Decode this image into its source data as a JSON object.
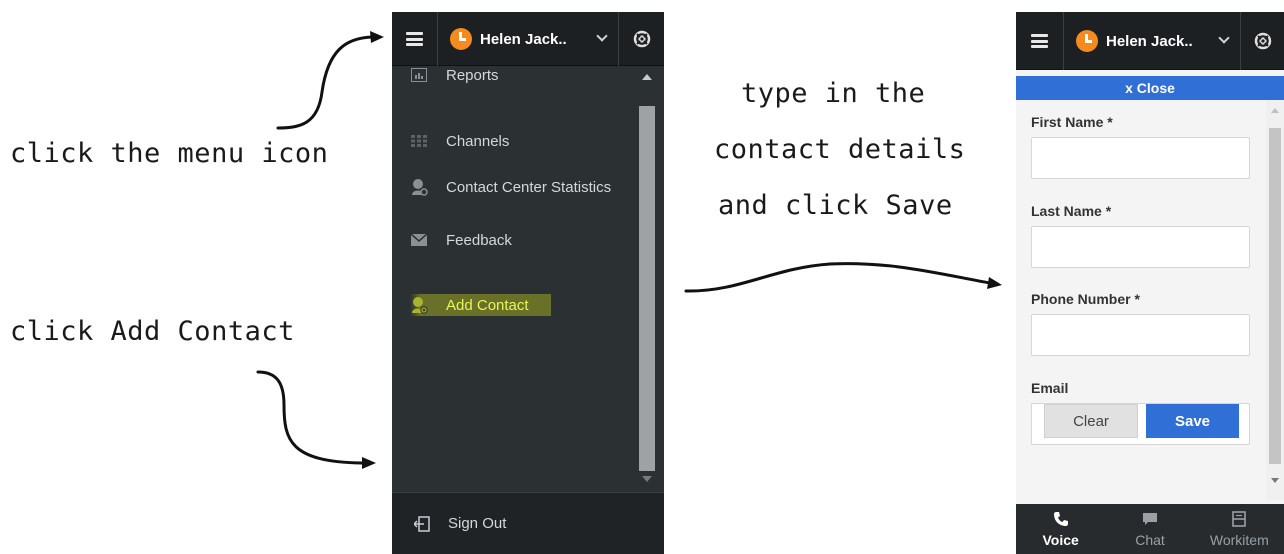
{
  "annotations": {
    "menu_icon": "click the menu icon",
    "add_contact": "click Add Contact",
    "type_line1": "type in the",
    "type_line2": "contact details",
    "type_line3": "and click Save"
  },
  "header": {
    "user_name": "Helen Jack..",
    "status_icon": "clock-icon",
    "ring_icon": "lifebuoy-icon"
  },
  "menu": {
    "items": [
      {
        "label": "Reports",
        "icon": "reports-icon"
      },
      {
        "label": "Channels",
        "icon": "grid-icon"
      },
      {
        "label": "Contact Center Statistics",
        "icon": "statistics-icon"
      },
      {
        "label": "Feedback",
        "icon": "envelope-icon"
      },
      {
        "label": "Add Contact",
        "icon": "add-contact-icon"
      }
    ],
    "sign_out": "Sign Out"
  },
  "form": {
    "close": "x Close",
    "first_name_label": "First Name *",
    "last_name_label": "Last Name *",
    "phone_label": "Phone Number *",
    "email_label": "Email",
    "clear": "Clear",
    "save": "Save"
  },
  "tabs": [
    {
      "label": "Voice",
      "icon": "phone-icon",
      "active": true
    },
    {
      "label": "Chat",
      "icon": "chat-icon",
      "active": false
    },
    {
      "label": "Workitem",
      "icon": "workitem-icon",
      "active": false
    }
  ],
  "colors": {
    "accent": "#2f6fd6",
    "highlight": "#e9f55a",
    "status": "#f58a1f",
    "panel": "#2b3033"
  }
}
